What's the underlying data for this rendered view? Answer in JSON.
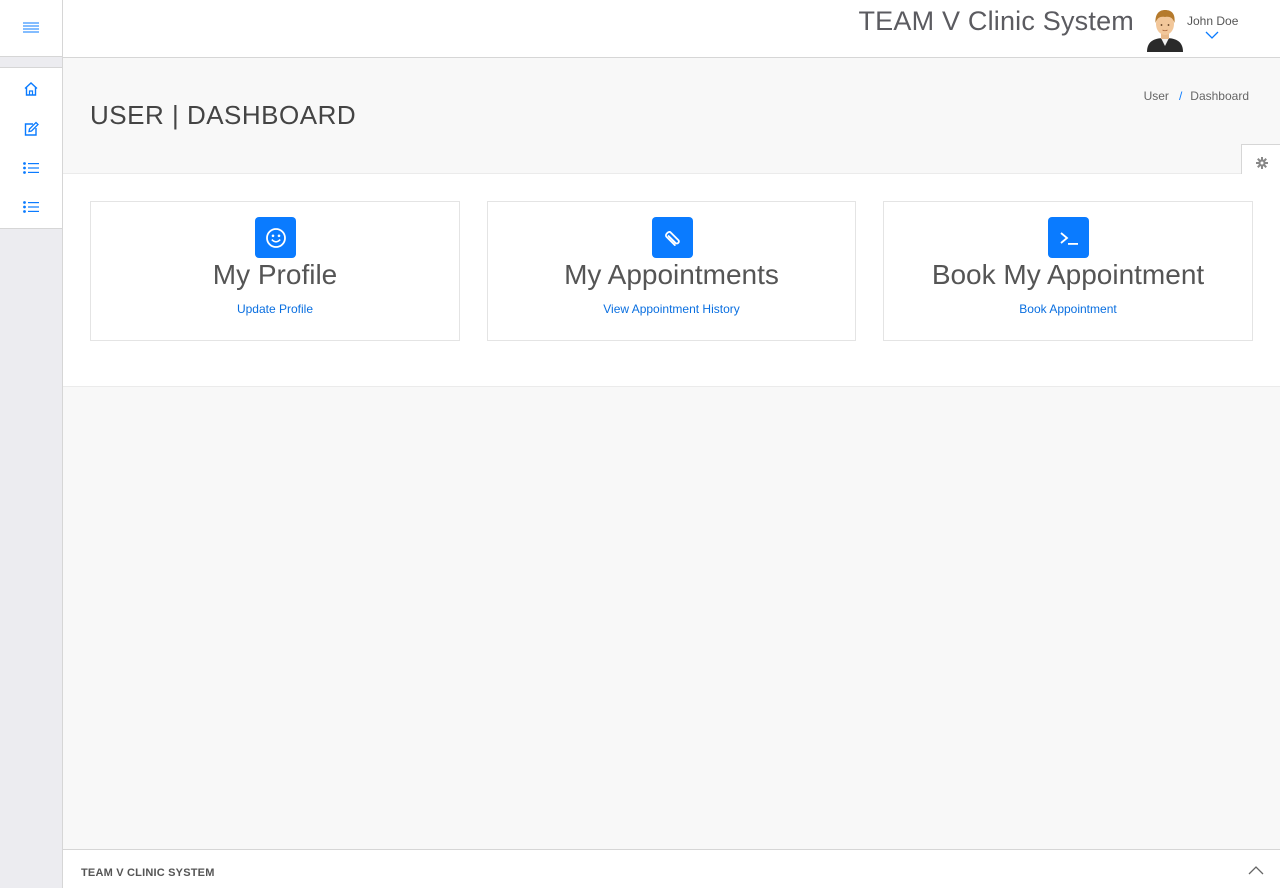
{
  "header": {
    "app_title": "TEAM V Clinic System",
    "user_name": "John Doe"
  },
  "sidebar": {
    "items": [
      {
        "name": "home",
        "icon": "home-icon"
      },
      {
        "name": "edit",
        "icon": "edit-icon"
      },
      {
        "name": "list-1",
        "icon": "list-icon"
      },
      {
        "name": "list-2",
        "icon": "list-icon"
      }
    ]
  },
  "page": {
    "title": "USER | DASHBOARD",
    "breadcrumb": [
      "User",
      "Dashboard"
    ],
    "breadcrumb_separator": "/"
  },
  "cards": [
    {
      "title": "My Profile",
      "link": "Update Profile",
      "icon": "smiley-icon"
    },
    {
      "title": "My Appointments",
      "link": "View Appointment History",
      "icon": "paperclip-icon"
    },
    {
      "title": "Book My Appointment",
      "link": "Book Appointment",
      "icon": "terminal-icon"
    }
  ],
  "footer": {
    "text": "TEAM V CLINIC SYSTEM"
  },
  "colors": {
    "accent": "#0a7bff"
  }
}
